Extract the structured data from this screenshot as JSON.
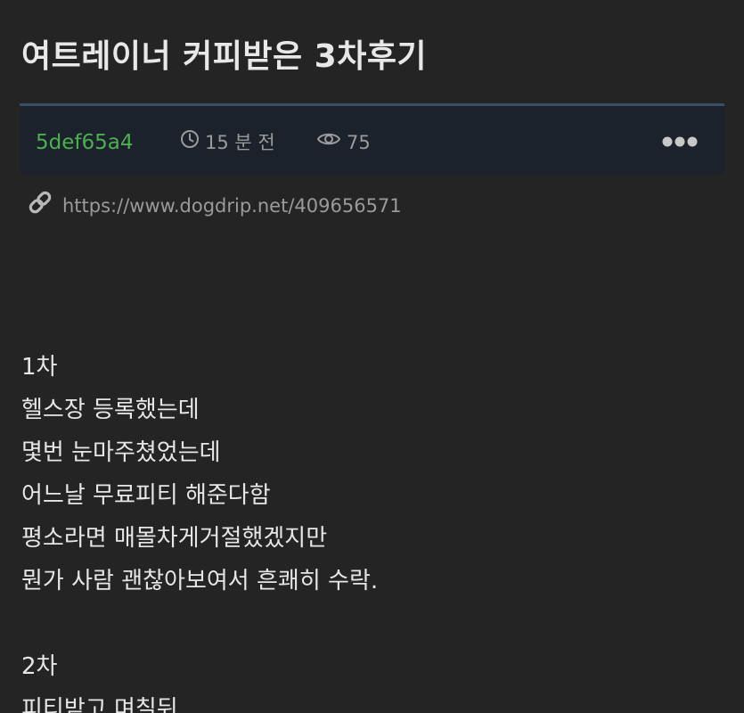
{
  "post": {
    "title": "여트레이너 커피받은 3차후기",
    "author": "5def65a4",
    "time": "15 분 전",
    "views": "75",
    "url": "https://www.dogdrip.net/409656571"
  },
  "icons": {
    "time": "clock-icon",
    "views": "eye-icon",
    "more": "more-dots-icon",
    "link": "link-icon"
  },
  "colors": {
    "background": "#242424",
    "meta_bar": "#1c222b",
    "meta_border": "#3a4f66",
    "author": "#4caf50",
    "muted": "#9a9a9a",
    "text": "#e6e6e6"
  },
  "content": {
    "section1": {
      "heading": "1차",
      "lines": [
        "헬스장 등록했는데",
        "몇번 눈마주쳤었는데",
        "어느날 무료피티 해준다함",
        "평소라면 매몰차게거절했겠지만",
        "뭔가 사람 괜찮아보여서 흔쾌히 수락."
      ]
    },
    "section2": {
      "heading": "2차",
      "lines": [
        "피티받고 며칠뒤"
      ]
    }
  }
}
